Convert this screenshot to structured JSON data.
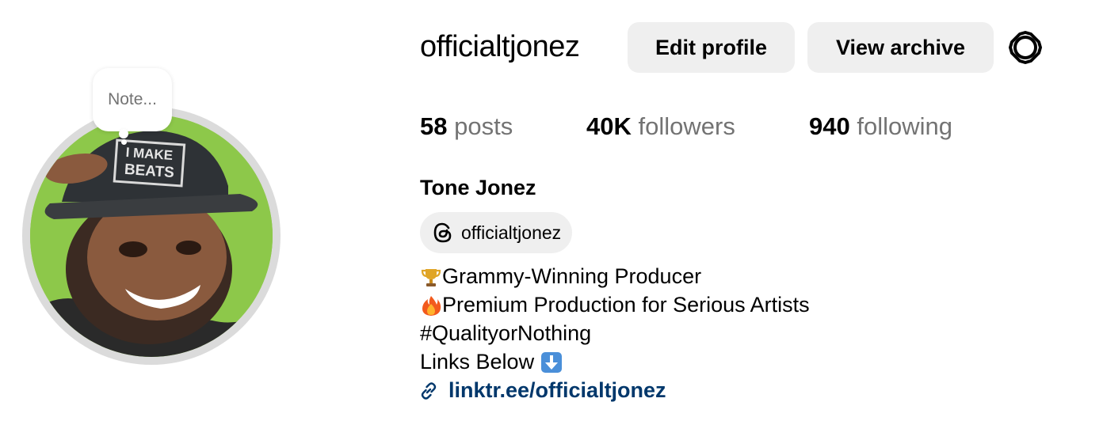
{
  "profile": {
    "username": "officialtjonez",
    "full_name": "Tone Jonez",
    "avatar_caption": "I MAKE BEATS",
    "note_placeholder": "Note...",
    "threads_handle": "officialtjonez"
  },
  "actions": {
    "edit_profile": "Edit profile",
    "view_archive": "View archive",
    "settings_icon": "gear-icon"
  },
  "stats": {
    "posts": {
      "count": "58",
      "label": "posts"
    },
    "followers": {
      "count": "40K",
      "label": "followers"
    },
    "following": {
      "count": "940",
      "label": "following"
    }
  },
  "bio": {
    "line1": "Grammy-Winning Producer",
    "line2": "Premium Production for Serious Artists",
    "line3": "#QualityorNothing",
    "line4": "Links Below",
    "link": "linktr.ee/officialtjonez"
  },
  "colors": {
    "button_bg": "#efefef",
    "muted_text": "#737373",
    "link": "#00376b",
    "avatar_bg": "#8dc84a"
  }
}
